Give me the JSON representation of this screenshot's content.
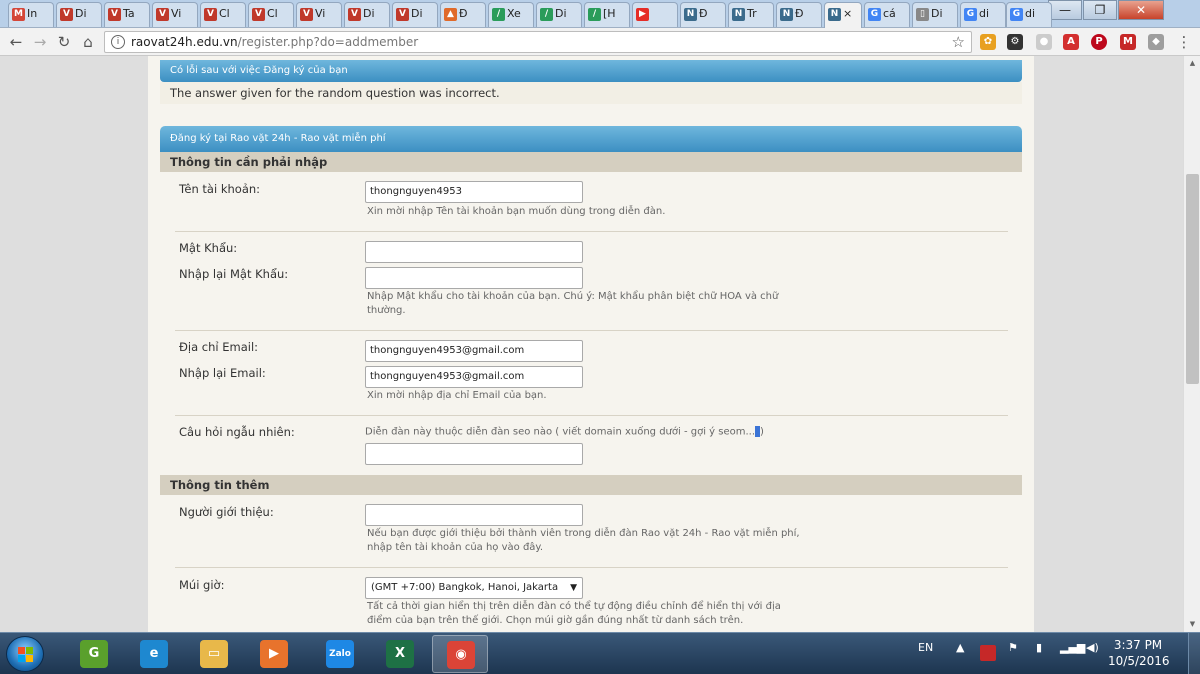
{
  "browser": {
    "tabs": [
      {
        "label": "In",
        "fav": "M",
        "color": "#d44638"
      },
      {
        "label": "Di",
        "fav": "V",
        "color": "#c0392b"
      },
      {
        "label": "Ta",
        "fav": "V",
        "color": "#c0392b"
      },
      {
        "label": "Vi",
        "fav": "V",
        "color": "#c0392b"
      },
      {
        "label": "Cl",
        "fav": "V",
        "color": "#c0392b"
      },
      {
        "label": "Cl",
        "fav": "V",
        "color": "#c0392b"
      },
      {
        "label": "Vi",
        "fav": "V",
        "color": "#c0392b"
      },
      {
        "label": "Di",
        "fav": "V",
        "color": "#c0392b"
      },
      {
        "label": "Di",
        "fav": "V",
        "color": "#c0392b"
      },
      {
        "label": "Đ",
        "fav": "▲",
        "color": "#e06a2a"
      },
      {
        "label": "Xe",
        "fav": "/",
        "color": "#2a9c5a"
      },
      {
        "label": "Di",
        "fav": "/",
        "color": "#2a9c5a"
      },
      {
        "label": "[H",
        "fav": "/",
        "color": "#2a9c5a"
      },
      {
        "label": "",
        "fav": "▶",
        "color": "#e52d27"
      },
      {
        "label": "Đ",
        "fav": "N",
        "color": "#3b6b8c"
      },
      {
        "label": "Tr",
        "fav": "N",
        "color": "#3b6b8c"
      },
      {
        "label": "Đ",
        "fav": "N",
        "color": "#3b6b8c"
      },
      {
        "label": "×",
        "fav": "N",
        "color": "#3b6b8c"
      },
      {
        "label": "cá",
        "fav": "G",
        "color": "#4285f4"
      },
      {
        "label": "Di",
        "fav": "▯",
        "color": "#888888"
      },
      {
        "label": "di",
        "fav": "G",
        "color": "#4285f4"
      },
      {
        "label": "di",
        "fav": "G",
        "color": "#4285f4"
      }
    ],
    "url_host": "raovat24h.edu.vn",
    "url_path": "/register.php?do=addmember",
    "minimize": "—",
    "maximize": "❐",
    "close": "✕"
  },
  "error": {
    "title": "Có lỗi sau với việc Đăng ký của bạn",
    "message": "The answer given for the random question was incorrect."
  },
  "form": {
    "title": "Đăng ký tại Rao vặt 24h - Rao vặt miễn phí",
    "section_required": "Thông tin cần phải nhập",
    "username_label": "Tên tài khoản:",
    "username_value": "thongnguyen4953",
    "username_desc": "Xin mời nhập Tên tài khoản bạn muốn dùng trong diễn đàn.",
    "password_label": "Mật Khẩu:",
    "password_confirm_label": "Nhập lại Mật Khẩu:",
    "password_desc_1": "Nhập Mật khẩu cho tài khoản của bạn. Chú ý: Mật khẩu phân biệt chữ HOA và chữ",
    "password_desc_2": "thường.",
    "email_label": "Địa chỉ Email:",
    "email_value": "thongnguyen4953@gmail.com",
    "email_confirm_label": "Nhập lại Email:",
    "email_confirm_value": "thongnguyen4953@gmail.com",
    "email_desc": "Xin mời nhập địa chỉ Email của bạn.",
    "question_label": "Câu hỏi ngẫu nhiên:",
    "question_text": "Diễn đàn này thuộc diễn đàn seo nào ( viết domain xuống dưới - gợi ý seom...",
    "question_tail": ")",
    "section_extra": "Thông tin thêm",
    "referrer_label": "Người giới thiệu:",
    "referrer_desc_1": "Nếu bạn được giới thiệu bởi thành viên trong diễn đàn Rao vặt 24h - Rao vặt miễn phí,",
    "referrer_desc_2": "nhập tên tài khoản của họ vào đây.",
    "timezone_label": "Múi giờ:",
    "timezone_value": "(GMT +7:00) Bangkok, Hanoi, Jakarta",
    "timezone_desc_1": "Tất cả thời gian hiển thị trên diễn đàn có thể tự động điều chỉnh để hiển thị với địa",
    "timezone_desc_2": "điểm của bạn trên thế giới. Chọn múi giờ gần đúng nhất từ danh sách trên."
  },
  "taskbar": {
    "apps": [
      {
        "name": "coccoc",
        "glyph": "G",
        "color": "#5aa02c"
      },
      {
        "name": "internet-explorer",
        "glyph": "e",
        "color": "#1e88d0"
      },
      {
        "name": "file-explorer",
        "glyph": "▭",
        "color": "#e8b84a"
      },
      {
        "name": "media-player",
        "glyph": "▶",
        "color": "#e8732c"
      },
      {
        "name": "zalo",
        "glyph": "Zalo",
        "color": "#1e88e5"
      },
      {
        "name": "excel",
        "glyph": "X",
        "color": "#1e7145"
      },
      {
        "name": "chrome",
        "glyph": "◉",
        "color": "#db4437"
      }
    ],
    "lang": "EN",
    "time": "3:37 PM",
    "date": "10/5/2016"
  }
}
